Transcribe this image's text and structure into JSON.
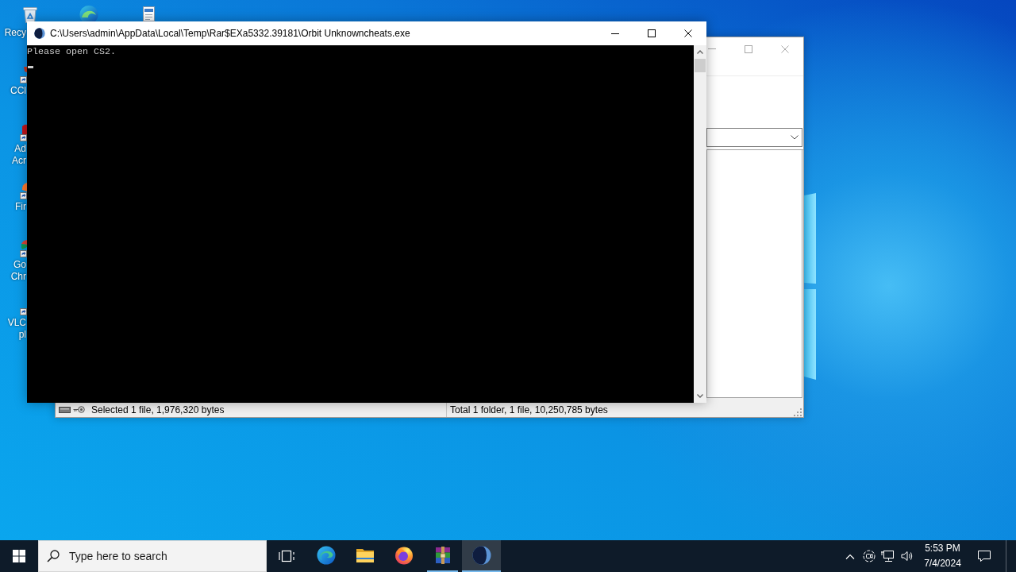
{
  "desktop": {
    "icons": [
      {
        "label_lines": [
          "Recy"
        ]
      },
      {
        "label_lines": [
          "CCl"
        ]
      },
      {
        "label_lines": [
          "Ad",
          "Acr"
        ]
      },
      {
        "label_lines": [
          "Fir"
        ]
      },
      {
        "label_lines": [
          "Go",
          "Chr"
        ]
      },
      {
        "label_lines": [
          "VLC",
          "pl"
        ]
      }
    ]
  },
  "console_window": {
    "title": "C:\\Users\\admin\\AppData\\Local\\Temp\\Rar$EXa5332.39181\\Orbit Unknowncheats.exe",
    "lines": [
      "Please open CS2."
    ]
  },
  "archive_window": {
    "status_bar": {
      "selection": "Selected 1 file, 1,976,320 bytes",
      "totals": "Total 1 folder, 1 file, 10,250,785 bytes"
    }
  },
  "taskbar": {
    "search": {
      "placeholder": "Type here to search"
    },
    "apps": [
      {
        "running": false,
        "selected": false
      },
      {
        "running": false,
        "selected": false
      },
      {
        "running": false,
        "selected": false
      },
      {
        "running": true,
        "selected": false
      },
      {
        "running": true,
        "selected": true
      }
    ],
    "clock": {
      "time": "5:53 PM",
      "date": "7/4/2024"
    }
  }
}
